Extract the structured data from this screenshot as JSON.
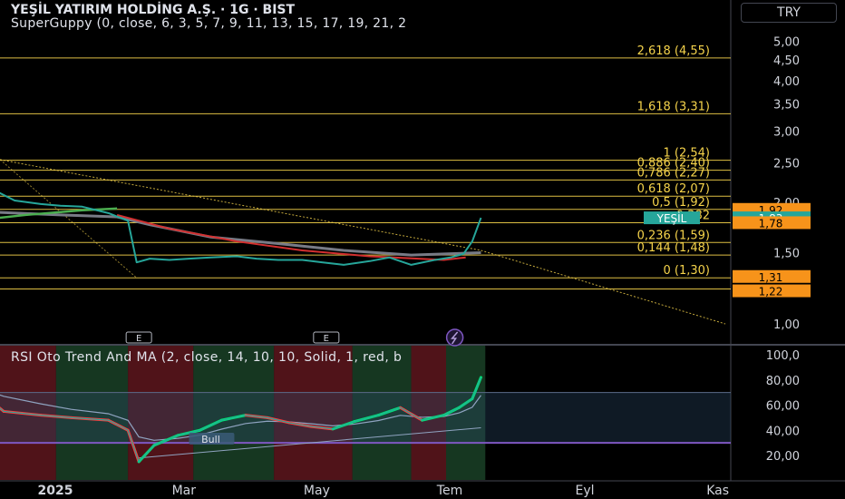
{
  "header": {
    "title": "YEŞİL YATIRIM HOLDİNG A.Ş. · 1G · BIST",
    "indicator": "SuperGuppy (0, close, 6, 3, 5, 7, 9, 11, 13, 15, 17, 19, 21, 2",
    "currency_button": "TRY"
  },
  "rsi_panel": {
    "title": "RSI Oto Trend And MA (2, close, 14, 10, 10, Solid, 1, red, b",
    "bull_label": "Bull"
  },
  "colors": {
    "background": "#000000",
    "fib_line": "#f5d34b",
    "fib_text": "#f5d34b",
    "price_tag": "#f7931a",
    "current_tag": "#26a69a",
    "price_line": "#26a69a",
    "ema_green": "#4caf50",
    "ema_red": "#d32f2f",
    "ema_grey": "#787b86",
    "rsi_line": "#26a69a",
    "rsi_bear_band": "#6b1a22",
    "rsi_bull_band": "#1e4a2c"
  },
  "chart_data": [
    {
      "type": "line",
      "title": "YEŞİL YATIRIM HOLDİNG A.Ş. · 1G · BIST",
      "y_scale": "log",
      "ylim": [
        0.9,
        5.0
      ],
      "y_ticks": [
        1.0,
        1.5,
        2.0,
        2.5,
        3.0,
        3.5,
        4.0,
        4.5,
        5.0
      ],
      "y_tick_labels": [
        "1,00",
        "1,50",
        "2,00",
        "2,50",
        "3,00",
        "3,50",
        "4,00",
        "4,50",
        "5,00"
      ],
      "x_labels": [
        "2025",
        "Mar",
        "May",
        "Tem",
        "Eyl",
        "Kas"
      ],
      "series": [
        {
          "name": "YEŞİL",
          "x": [
            "2024-12-01",
            "2024-12-10",
            "2024-12-20",
            "2025-01-01",
            "2025-01-10",
            "2025-01-20",
            "2025-02-01",
            "2025-02-10",
            "2025-02-14",
            "2025-02-20",
            "2025-03-01",
            "2025-03-10",
            "2025-03-20",
            "2025-04-01",
            "2025-04-10",
            "2025-04-20",
            "2025-05-01",
            "2025-05-10",
            "2025-05-20",
            "2025-06-01",
            "2025-06-10",
            "2025-06-20",
            "2025-07-01",
            "2025-07-08",
            "2025-07-14",
            "2025-07-18",
            "2025-07-22"
          ],
          "values": [
            2.4,
            2.15,
            2.02,
            1.98,
            1.96,
            1.95,
            1.88,
            1.8,
            1.42,
            1.45,
            1.44,
            1.45,
            1.46,
            1.47,
            1.45,
            1.44,
            1.44,
            1.42,
            1.4,
            1.43,
            1.46,
            1.4,
            1.44,
            1.46,
            1.49,
            1.6,
            1.83
          ]
        }
      ],
      "fib_levels": [
        {
          "label": "2,618 (4,55)",
          "value": 4.55
        },
        {
          "label": "1,618 (3,31)",
          "value": 3.31
        },
        {
          "label": "1 (2,54)",
          "value": 2.54
        },
        {
          "label": "0,886 (2,40)",
          "value": 2.4
        },
        {
          "label": "0,786 (2,27)",
          "value": 2.27
        },
        {
          "label": "0,618 (2,07)",
          "value": 2.07
        },
        {
          "label": "0,5 (1,92)",
          "value": 1.92
        },
        {
          "label": "0,382",
          "value": 1.78
        },
        {
          "label": "0,236 (1,59)",
          "value": 1.59
        },
        {
          "label": "0,144 (1,48)",
          "value": 1.48
        },
        {
          "label": "0 (1,30)",
          "value": 1.3
        }
      ],
      "price_tags": [
        {
          "label": "1,92",
          "value": 1.92,
          "kind": "level"
        },
        {
          "label": "YEŞİL",
          "value": 1.83,
          "kind": "symbol"
        },
        {
          "label": "1,83",
          "value": 1.83,
          "kind": "current"
        },
        {
          "label": "1,78",
          "value": 1.78,
          "kind": "level"
        },
        {
          "label": "1,31",
          "value": 1.31,
          "kind": "level"
        },
        {
          "label": "1,22",
          "value": 1.22,
          "kind": "level"
        }
      ],
      "event_markers": [
        {
          "label": "E",
          "x": "2025-02-15"
        },
        {
          "label": "E",
          "x": "2025-05-12"
        }
      ]
    },
    {
      "type": "line",
      "title": "RSI Oto Trend And MA (2, close, 14, 10, 10, Solid, 1, red, b",
      "ylim": [
        10,
        100
      ],
      "y_ticks": [
        20,
        40,
        60,
        80,
        100
      ],
      "y_tick_labels": [
        "20,00",
        "40,00",
        "60,00",
        "80,00",
        "100,0"
      ],
      "levels": [
        70,
        30
      ],
      "series": [
        {
          "name": "RSI",
          "x": [
            "2024-12-01",
            "2024-12-15",
            "2025-01-01",
            "2025-01-15",
            "2025-02-01",
            "2025-02-10",
            "2025-02-15",
            "2025-02-22",
            "2025-03-05",
            "2025-03-15",
            "2025-03-25",
            "2025-04-05",
            "2025-04-15",
            "2025-04-25",
            "2025-05-05",
            "2025-05-15",
            "2025-05-25",
            "2025-06-05",
            "2025-06-15",
            "2025-06-25",
            "2025-07-05",
            "2025-07-12",
            "2025-07-18",
            "2025-07-22"
          ],
          "values": [
            75,
            55,
            52,
            50,
            48,
            40,
            15,
            28,
            36,
            40,
            48,
            52,
            50,
            46,
            43,
            41,
            47,
            52,
            58,
            48,
            52,
            58,
            65,
            82
          ]
        }
      ]
    }
  ]
}
